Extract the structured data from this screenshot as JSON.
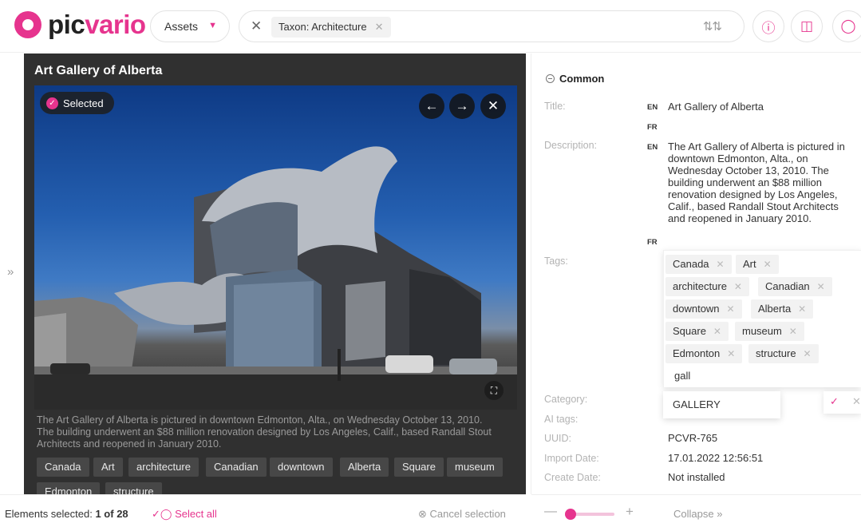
{
  "header": {
    "logo_pic": "pic",
    "logo_vario": "vario",
    "assets_select": "Assets",
    "filter_chip": "Taxon: Architecture"
  },
  "viewer": {
    "title": "Art Gallery of Alberta",
    "selected_badge": "Selected",
    "caption": "The Art Gallery of Alberta is pictured in downtown Edmonton, Alta., on Wednesday October 13, 2010. The building underwent an $88 million renovation designed by Los Angeles, Calif., based Randall Stout Architects and reopened in January 2010.",
    "tags": [
      "Canada",
      "Art",
      "architecture",
      "Canadian",
      "downtown",
      "Alberta",
      "Square",
      "museum",
      "Edmonton",
      "structure"
    ]
  },
  "bottom": {
    "elements_selected_label": "Elements selected:",
    "elements_selected_value": "1 of 28",
    "select_all": "Select all",
    "cancel_selection": "Cancel selection",
    "collapse": "Collapse"
  },
  "panel": {
    "section": "Common",
    "title_label": "Title:",
    "title_en": "Art Gallery of Alberta",
    "description_label": "Description:",
    "description_en": "The Art Gallery of Alberta is pictured in downtown Edmonton, Alta., on Wednesday October 13, 2010. The building underwent an $88 million renovation designed by Los Angeles, Calif., based Randall Stout Architects and reopened in January 2010.",
    "lang_en": "EN",
    "lang_fr": "FR",
    "tags_label": "Tags:",
    "tags": [
      "Canada",
      "Art",
      "architecture",
      "Canadian",
      "downtown",
      "Alberta",
      "Square",
      "museum",
      "Edmonton",
      "structure"
    ],
    "tag_typed": "gall",
    "category_label": "Category:",
    "category_value": "GALLERY",
    "ai_tags_label": "AI tags:",
    "uuid_label": "UUID:",
    "uuid_value": "PCVR-765",
    "import_date_label": "Import Date:",
    "import_date_value": "17.01.2022 12:56:51",
    "create_date_label": "Create Date:",
    "create_date_value": "Not installed"
  },
  "colors": {
    "accent": "#e6348e"
  }
}
